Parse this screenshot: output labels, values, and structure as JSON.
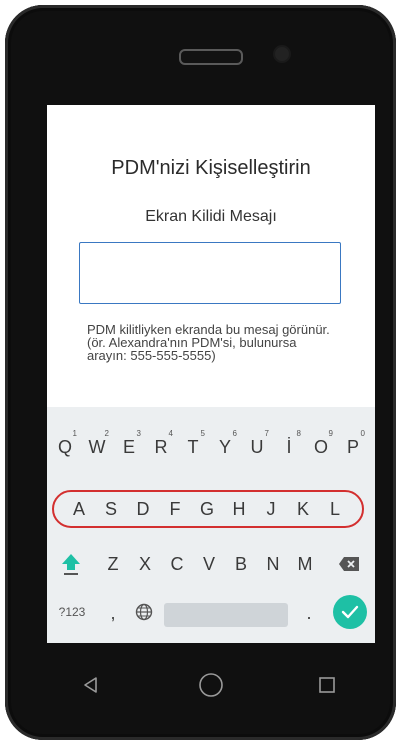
{
  "screen": {
    "title": "PDM'nizi Kişiselleştirin",
    "subtitle": "Ekran Kilidi Mesajı",
    "input_value": "",
    "helper_text": "PDM kilitliyken ekranda bu mesaj görünür. (ör. Alexandra'nın PDM'si, bulunursa arayın: 555-555-5555)"
  },
  "keyboard": {
    "row1": [
      {
        "label": "Q",
        "hint": "1"
      },
      {
        "label": "W",
        "hint": "2"
      },
      {
        "label": "E",
        "hint": "3"
      },
      {
        "label": "R",
        "hint": "4"
      },
      {
        "label": "T",
        "hint": "5"
      },
      {
        "label": "Y",
        "hint": "6"
      },
      {
        "label": "U",
        "hint": "7"
      },
      {
        "label": "İ",
        "hint": "8"
      },
      {
        "label": "O",
        "hint": "9"
      },
      {
        "label": "P",
        "hint": "0"
      }
    ],
    "row2": [
      "A",
      "S",
      "D",
      "F",
      "G",
      "H",
      "J",
      "K",
      "L"
    ],
    "row3": [
      "Z",
      "X",
      "C",
      "V",
      "B",
      "N",
      "M"
    ],
    "symbols_label": "?123",
    "comma_label": ",",
    "period_label": ".",
    "shift_icon": "shift-icon",
    "backspace_icon": "backspace-icon",
    "globe_icon": "globe-icon",
    "enter_icon": "checkmark-icon"
  },
  "navigation": {
    "back_icon": "back-triangle-icon",
    "home_icon": "home-circle-icon",
    "recents_icon": "recents-square-icon"
  },
  "colors": {
    "accent": "#1ec0a5",
    "input_border": "#3a78c2",
    "highlight": "#d32f2f",
    "keyboard_bg": "#eceff1"
  }
}
